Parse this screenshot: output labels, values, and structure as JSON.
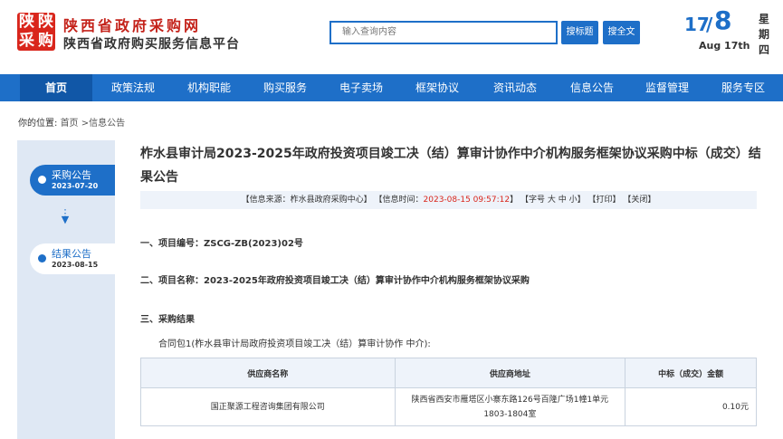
{
  "header": {
    "logo_chars": [
      "陕",
      "陕",
      "采",
      "购"
    ],
    "site_name": "陕西省政府采购网",
    "site_subtitle": "陕西省政府购买服务信息平台",
    "search_placeholder": "输入查询内容",
    "search_title_label": "搜标题",
    "search_full_label": "搜全文",
    "date_day": "17",
    "date_sep": "/",
    "date_month": "8",
    "date_en": "Aug 17th",
    "weekday": [
      "星",
      "期",
      "四"
    ]
  },
  "nav": {
    "items": [
      "首页",
      "政策法规",
      "机构职能",
      "购买服务",
      "电子卖场",
      "框架协议",
      "资讯动态",
      "信息公告",
      "监督管理",
      "服务专区"
    ]
  },
  "breadcrumb": {
    "label": "你的位置:",
    "home": "首页",
    "current": ">信息公告"
  },
  "sidebar": {
    "steps": [
      {
        "label": "采购公告",
        "date": "2023-07-20"
      },
      {
        "label": "结果公告",
        "date": "2023-08-15"
      }
    ]
  },
  "article": {
    "title": "柞水县审计局2023-2025年政府投资项目竣工决（结）算审计协作中介机构服务框架协议采购中标（成交）结果公告",
    "meta_source": "【信息来源：柞水县政府采购中心】",
    "meta_time_label": "【信息时间：",
    "meta_time": "2023-08-15 09:57:12",
    "meta_time_close": "】",
    "meta_font": "【字号 大 中 小】",
    "meta_print": "【打印】",
    "meta_close": "【关闭】",
    "sec1": "一、项目编号：ZSCG-ZB(2023)02号",
    "sec2": "二、项目名称：2023-2025年政府投资项目竣工决（结）算审计协作中介机构服务框架协议采购",
    "sec3": "三、采购结果",
    "package": "合同包1(柞水县审计局政府投资项目竣工决（结）算审计协作 中介):",
    "table": {
      "headers": [
        "供应商名称",
        "供应商地址",
        "中标（成交）金额"
      ],
      "rows": [
        [
          "国正聚源工程咨询集团有限公司",
          "陕西省西安市雁塔区小寨东路126号百隆广场1幢1单元1803-1804室",
          "0.10元"
        ]
      ]
    }
  },
  "colors": {
    "brand_blue": "#1e6fc8",
    "brand_red": "#d9261c"
  }
}
